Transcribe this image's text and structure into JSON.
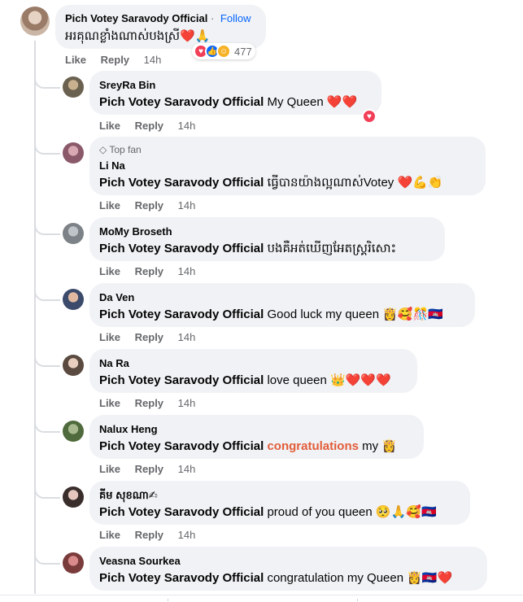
{
  "top": {
    "author": "Pich Votey Saravody Official",
    "separator": "·",
    "follow": "Follow",
    "text": "អរគុណខ្លាំងណាស់បងស្រី❤️🙏",
    "like": "Like",
    "reply": "Reply",
    "time": "14h",
    "reaction_count": "477"
  },
  "replies": [
    {
      "author": "SreyRa Bin",
      "tag": "Pich Votey Saravody Official",
      "text": "My Queen ❤️❤️",
      "like": "Like",
      "reply": "Reply",
      "time": "14h"
    },
    {
      "badge": "Top fan",
      "author": "Li Na",
      "tag": "Pich Votey Saravody Official",
      "text": "ធ្វើបានយ៉ាងល្អណាស់Votey ❤️💪👏",
      "like": "Like",
      "reply": "Reply",
      "time": "14h"
    },
    {
      "author": "MoMy Broseth",
      "tag": "Pich Votey Saravody Official",
      "text": "បងគឺអត់ឃើញអែតស្រ្គរិសោះ",
      "like": "Like",
      "reply": "Reply",
      "time": "14h"
    },
    {
      "author": "Da Ven",
      "tag": "Pich Votey Saravody Official",
      "text": "Good luck my queen 👸🥰🎊🇰🇭",
      "like": "Like",
      "reply": "Reply",
      "time": "14h"
    },
    {
      "author": "Na Ra",
      "tag": "Pich Votey Saravody Official",
      "text": "love queen 👑❤️❤️❤️",
      "like": "Like",
      "reply": "Reply",
      "time": "14h"
    },
    {
      "author": "Nalux Heng",
      "tag": "Pich Votey Saravody Official",
      "highlight": "congratulations",
      "text": " my 👸",
      "like": "Like",
      "reply": "Reply",
      "time": "14h"
    },
    {
      "author": "គីម សុខណា✍",
      "tag": "Pich Votey Saravody Official",
      "text": "proud of you queen 🥺🙏🥰🇰🇭",
      "like": "Like",
      "reply": "Reply",
      "time": "14h"
    },
    {
      "author": "Veasna Sourkea",
      "tag": "Pich Votey Saravody Official",
      "text": "congratulation my Queen 👸🇰🇭❤️"
    }
  ]
}
